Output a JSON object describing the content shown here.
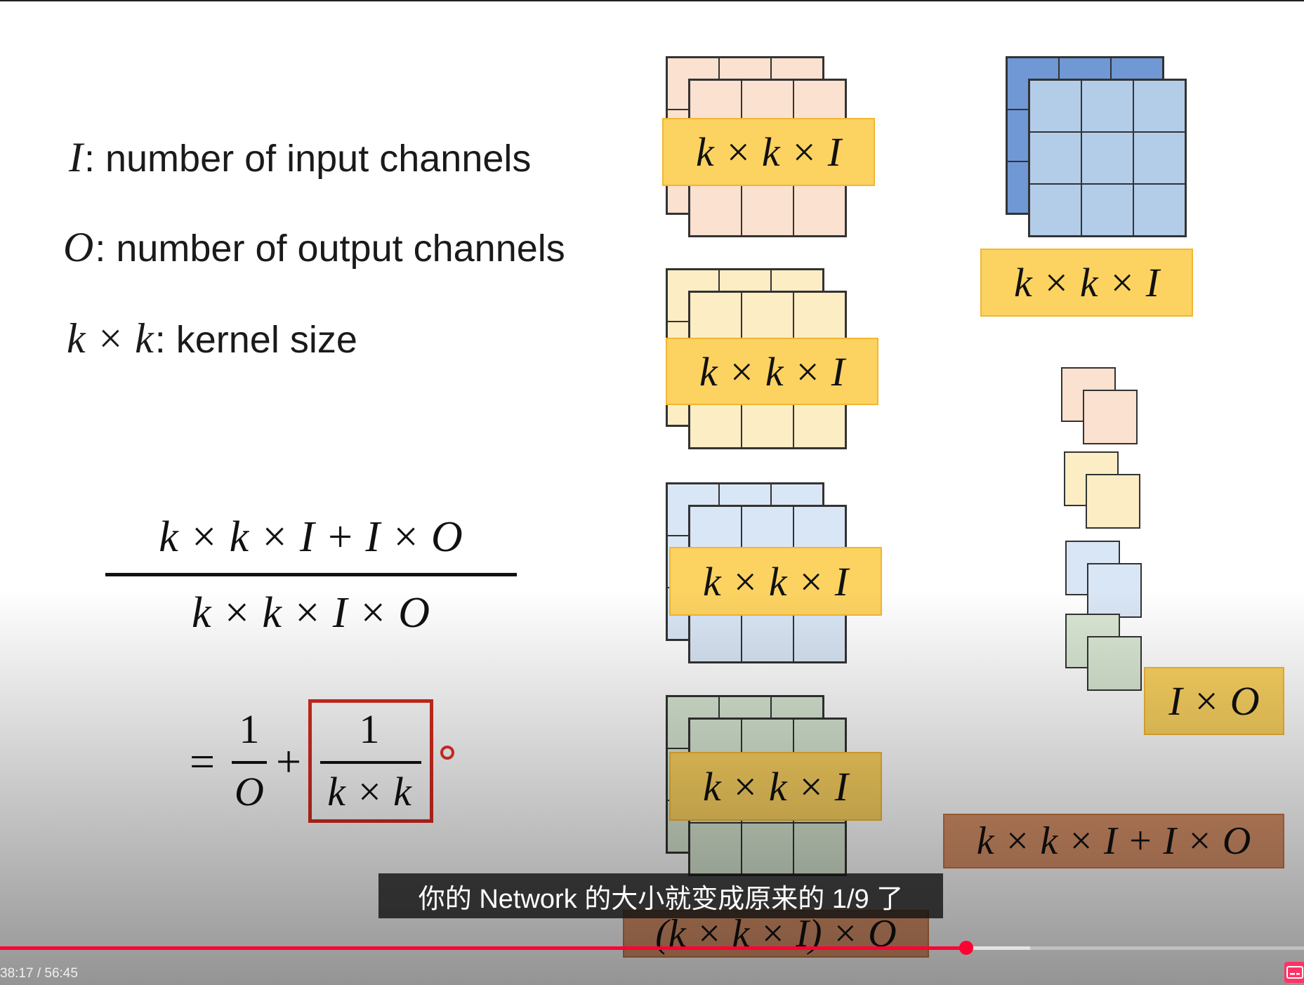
{
  "slide": {
    "definitions": [
      {
        "symbol": "I",
        "text": ": number of input channels"
      },
      {
        "symbol": "O",
        "text": ": number of output channels"
      },
      {
        "symbol": "k × k",
        "text": ": kernel size"
      }
    ],
    "ratio": {
      "numerator": "k × k × I + I × O",
      "denominator": "k × k × I × O"
    },
    "result": {
      "equals": "=",
      "term1_num": "1",
      "term1_den": "O",
      "plus": "+",
      "term2_num": "1",
      "term2_den": "k × k"
    },
    "depthwise_filter_label": "k × k × I",
    "standard_filter_label": "k × k × I",
    "pointwise_label": "I × O",
    "total_separable": "k × k × I + I × O",
    "total_standard": "(k × k × I) × O",
    "colors": {
      "peach": "#fbe1cf",
      "yellow": "#fdedc4",
      "light_blue": "#d9e6f5",
      "green": "#d9e7d3",
      "filter_blue": "#b3cde9",
      "filter_blue_back": "#6f98d4",
      "label_yellow": "#fcd361",
      "label_orange": "#d8926a",
      "highlight_red": "#d62b1f"
    }
  },
  "player": {
    "subtitle": "你的 Network 的大小就变成原来的 1/9 了",
    "time_current": "38:17",
    "time_separator": " / ",
    "time_total": "56:45",
    "progress": 0.741,
    "buffered": 0.79,
    "cc_icon": "subtitles-icon"
  }
}
